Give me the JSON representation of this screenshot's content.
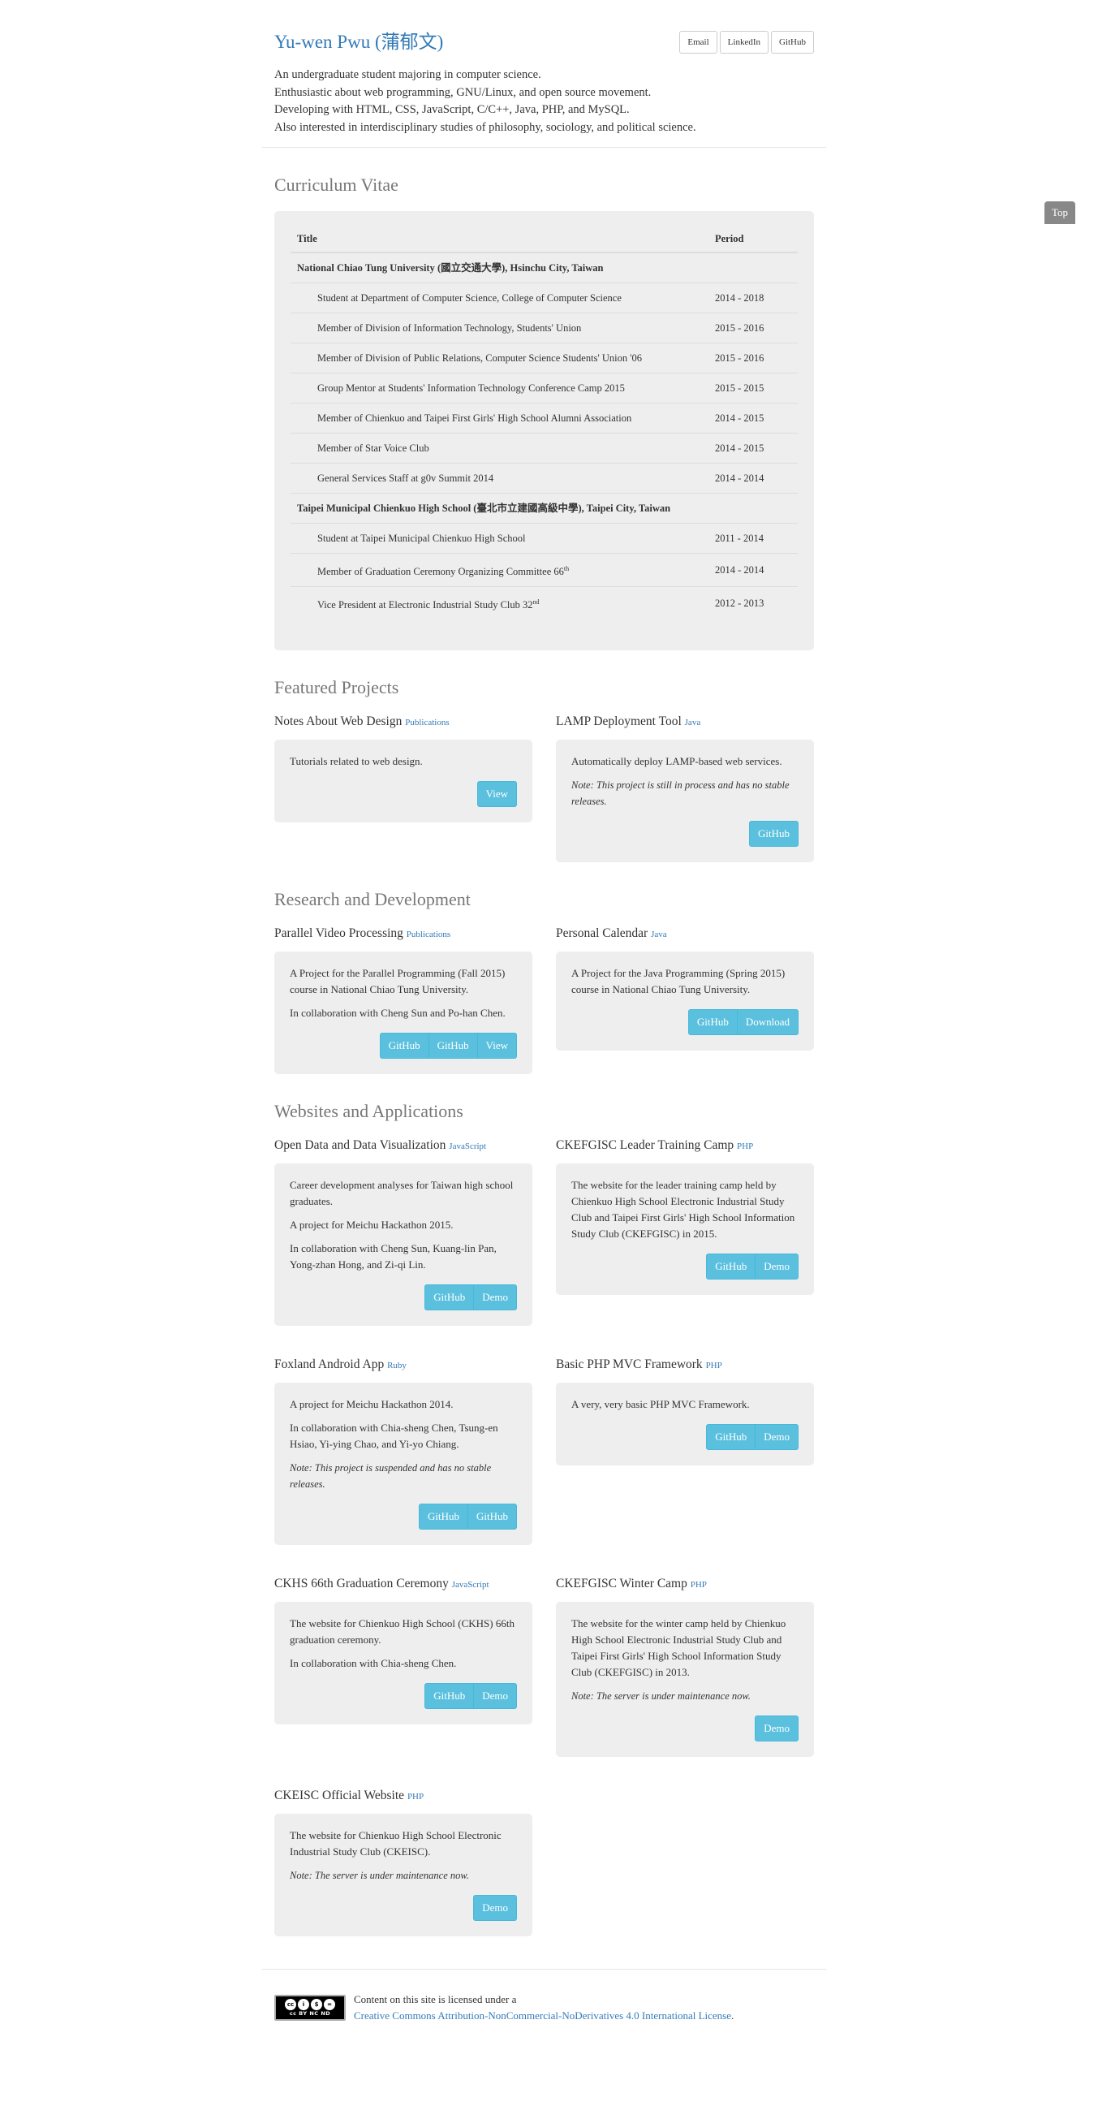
{
  "header": {
    "name": "Yu-wen Pwu (蒲郁文)",
    "buttons": [
      "Email",
      "LinkedIn",
      "GitHub"
    ],
    "intro": [
      "An undergraduate student majoring in computer science.",
      "Enthusiastic about web programming, GNU/Linux, and open source movement.",
      "Developing with HTML, CSS, JavaScript, C/C++, Java, PHP, and MySQL.",
      "Also interested in interdisciplinary studies of philosophy, sociology, and political science."
    ]
  },
  "top_label": "Top",
  "cv": {
    "heading": "Curriculum Vitae",
    "col_title": "Title",
    "col_period": "Period",
    "groups": [
      {
        "name": "National Chiao Tung University (國立交通大學), Hsinchu City, Taiwan",
        "items": [
          {
            "title": "Student at Department of Computer Science, College of Computer Science",
            "sup": "",
            "period": "2014 - 2018"
          },
          {
            "title": "Member of Division of Information Technology, Students' Union",
            "sup": "",
            "period": "2015 - 2016"
          },
          {
            "title": "Member of Division of Public Relations, Computer Science Students' Union '06",
            "sup": "",
            "period": "2015 - 2016"
          },
          {
            "title": "Group Mentor at Students' Information Technology Conference Camp 2015",
            "sup": "",
            "period": "2015 - 2015"
          },
          {
            "title": "Member of Chienkuo and Taipei First Girls' High School Alumni Association",
            "sup": "",
            "period": "2014 - 2015"
          },
          {
            "title": "Member of Star Voice Club",
            "sup": "",
            "period": "2014 - 2015"
          },
          {
            "title": "General Services Staff at g0v Summit 2014",
            "sup": "",
            "period": "2014 - 2014"
          }
        ]
      },
      {
        "name": "Taipei Municipal Chienkuo High School (臺北市立建國高級中學), Taipei City, Taiwan",
        "items": [
          {
            "title": "Student at Taipei Municipal Chienkuo High School",
            "sup": "",
            "period": "2011 - 2014"
          },
          {
            "title": "Member of Graduation Ceremony Organizing Committee 66",
            "sup": "th",
            "period": "2014 - 2014"
          },
          {
            "title": "Vice President at Electronic Industrial Study Club 32",
            "sup": "nd",
            "period": "2012 - 2013"
          }
        ]
      }
    ]
  },
  "sections": [
    {
      "heading": "Featured Projects",
      "projects": [
        {
          "title": "Notes About Web Design",
          "lang": "Publications",
          "paras": [
            "Tutorials related to web design."
          ],
          "note": "",
          "buttons": [
            "View"
          ]
        },
        {
          "title": "LAMP Deployment Tool",
          "lang": "Java",
          "paras": [
            "Automatically deploy LAMP-based web services."
          ],
          "note": "Note: This project is still in process and has no stable releases.",
          "buttons": [
            "GitHub"
          ]
        }
      ]
    },
    {
      "heading": "Research and Development",
      "projects": [
        {
          "title": "Parallel Video Processing",
          "lang": "Publications",
          "paras": [
            "A Project for the Parallel Programming (Fall 2015) course in National Chiao Tung University.",
            "In collaboration with Cheng Sun and Po-han Chen."
          ],
          "note": "",
          "buttons": [
            "GitHub",
            "GitHub",
            "View"
          ]
        },
        {
          "title": "Personal Calendar",
          "lang": "Java",
          "paras": [
            "A Project for the Java Programming (Spring 2015) course in National Chiao Tung University."
          ],
          "note": "",
          "buttons": [
            "GitHub",
            "Download"
          ]
        }
      ]
    },
    {
      "heading": "Websites and Applications",
      "projects": [
        {
          "title": "Open Data and Data Visualization",
          "lang": "JavaScript",
          "paras": [
            "Career development analyses for Taiwan high school graduates.",
            "A project for Meichu Hackathon 2015.",
            "In collaboration with Cheng Sun, Kuang-lin Pan, Yong-zhan Hong, and Zi-qi Lin."
          ],
          "note": "",
          "buttons": [
            "GitHub",
            "Demo"
          ]
        },
        {
          "title": "CKEFGISC Leader Training Camp",
          "lang": "PHP",
          "paras": [
            "The website for the leader training camp held by Chienkuo High School Electronic Industrial Study Club and Taipei First Girls' High School Information Study Club (CKEFGISC) in 2015."
          ],
          "note": "",
          "buttons": [
            "GitHub",
            "Demo"
          ]
        },
        {
          "title": "Foxland Android App",
          "lang": "Ruby",
          "paras": [
            "A project for Meichu Hackathon 2014.",
            "In collaboration with Chia-sheng Chen, Tsung-en Hsiao, Yi-ying Chao, and Yi-yo Chiang."
          ],
          "note": "Note: This project is suspended and has no stable releases.",
          "buttons": [
            "GitHub",
            "GitHub"
          ]
        },
        {
          "title": "Basic PHP MVC Framework",
          "lang": "PHP",
          "paras": [
            "A very, very basic PHP MVC Framework."
          ],
          "note": "",
          "buttons": [
            "GitHub",
            "Demo"
          ]
        },
        {
          "title": "CKHS 66th Graduation Ceremony",
          "lang": "JavaScript",
          "paras": [
            "The website for Chienkuo High School (CKHS) 66th graduation ceremony.",
            "In collaboration with Chia-sheng Chen."
          ],
          "note": "",
          "buttons": [
            "GitHub",
            "Demo"
          ]
        },
        {
          "title": "CKEFGISC Winter Camp",
          "lang": "PHP",
          "paras": [
            "The website for the winter camp held by Chienkuo High School Electronic Industrial Study Club and Taipei First Girls' High School Information Study Club (CKEFGISC) in 2013."
          ],
          "note": "Note: The server is under maintenance now.",
          "buttons": [
            "Demo"
          ]
        },
        {
          "title": "CKEISC Official Website",
          "lang": "PHP",
          "paras": [
            "The website for Chienkuo High School Electronic Industrial Study Club (CKEISC)."
          ],
          "note": "Note: The server is under maintenance now.",
          "buttons": [
            "Demo"
          ]
        }
      ]
    }
  ],
  "footer": {
    "text": "Content on this site is licensed under a",
    "link": "Creative Commons Attribution-NonCommercial-NoDerivatives 4.0 International License",
    "period": ".",
    "badge": "cc BY NC ND"
  }
}
